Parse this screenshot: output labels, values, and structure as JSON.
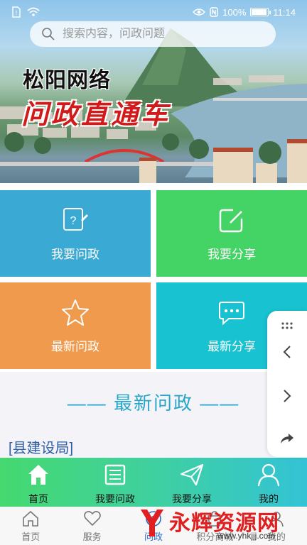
{
  "status_bar": {
    "battery": "100%",
    "time": "11:14",
    "battery_level": 1.0
  },
  "search": {
    "placeholder": "搜索内容，问政问题"
  },
  "banner": {
    "title_line1": "松阳网络",
    "title_line2": "问政直通车"
  },
  "tiles": [
    {
      "label": "我要问政",
      "color": "#3aa9d3",
      "icon": "question-edit-icon"
    },
    {
      "label": "我要分享",
      "color": "#44d466",
      "icon": "edit-square-icon"
    },
    {
      "label": "最新问政",
      "color": "#ef9a4c",
      "icon": "star-icon"
    },
    {
      "label": "最新分享",
      "color": "#18c2d0",
      "icon": "chat-bubble-icon"
    }
  ],
  "latest": {
    "heading": "—— 最新问政 ——",
    "department_tag": "[县建设局]"
  },
  "app_tabs": [
    {
      "label": "首页",
      "icon": "home-icon"
    },
    {
      "label": "我要问政",
      "icon": "document-icon"
    },
    {
      "label": "我要分享",
      "icon": "paper-plane-icon"
    },
    {
      "label": "我的",
      "icon": "user-icon"
    }
  ],
  "host_nav": [
    {
      "label": "首页",
      "icon": "house-outline-icon"
    },
    {
      "label": "服务",
      "icon": "heart-icon"
    },
    {
      "label": "问政",
      "icon": "question-icon"
    },
    {
      "label": "积分商城",
      "icon": "shop-icon"
    },
    {
      "label": "我的",
      "icon": "person-outline-icon"
    }
  ],
  "watermark": {
    "text": "永辉资源网",
    "url": "www.yhkjjj.com"
  },
  "colors": {
    "accent": "#26a6c9",
    "tab_gradient_start": "#45d96f",
    "tab_gradient_end": "#33c3d6",
    "host_active": "#2a6ac8"
  }
}
